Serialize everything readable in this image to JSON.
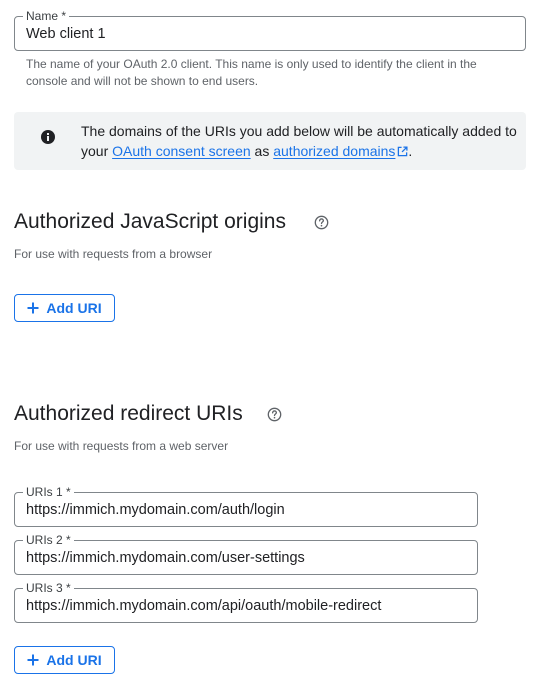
{
  "name_field": {
    "label": "Name *",
    "value": "Web client 1",
    "helper": "The name of your OAuth 2.0 client. This name is only used to identify the client in the console and will not be shown to end users."
  },
  "banner": {
    "icon": "info-icon",
    "text_before": "The domains of the URIs you add below will be automatically added to your ",
    "consent_link": "OAuth consent screen",
    "text_middle": " as ",
    "domains_link": "authorized domains",
    "text_after": "."
  },
  "js_origins": {
    "title": "Authorized JavaScript origins",
    "help_icon": "help-circle-icon",
    "helper": "For use with requests from a browser",
    "add_button": "Add URI"
  },
  "redirect_uris": {
    "title": "Authorized redirect URIs",
    "help_icon": "help-circle-icon",
    "helper": "For use with requests from a web server",
    "fields": [
      {
        "label": "URIs 1 *",
        "value": "https://immich.mydomain.com/auth/login"
      },
      {
        "label": "URIs 2 *",
        "value": "https://immich.mydomain.com/user-settings"
      },
      {
        "label": "URIs 3 *",
        "value": "https://immich.mydomain.com/api/oauth/mobile-redirect"
      }
    ],
    "add_button": "Add URI"
  },
  "colors": {
    "accent": "#1a73e8",
    "banner_bg": "#f1f3f4",
    "border": "#80868b",
    "text_secondary": "#5f6368"
  }
}
